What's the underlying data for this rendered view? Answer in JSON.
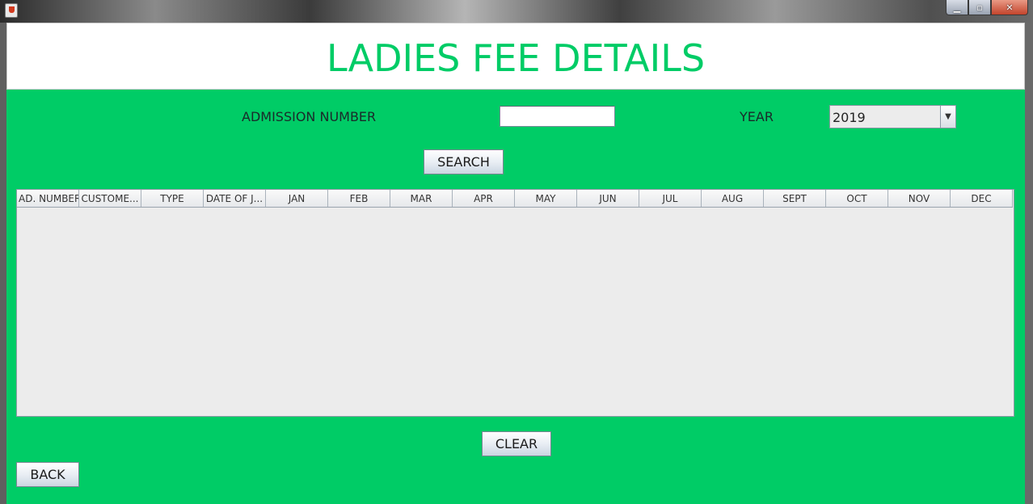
{
  "window": {
    "min_glyph": "▁",
    "max_glyph": "▫",
    "close_glyph": "✕"
  },
  "header": {
    "title": "LADIES FEE DETAILS"
  },
  "form": {
    "admission_label": "ADMISSION NUMBER",
    "admission_value": "",
    "year_label": "YEAR",
    "year_value": "2019",
    "year_arrow": "▼",
    "search_label": "SEARCH"
  },
  "table": {
    "columns": [
      "AD. NUMBER",
      "CUSTOME...",
      "TYPE",
      "DATE OF J...",
      "JAN",
      "FEB",
      "MAR",
      "APR",
      "MAY",
      "JUN",
      "JUL",
      "AUG",
      "SEPT",
      "OCT",
      "NOV",
      "DEC"
    ],
    "rows": []
  },
  "actions": {
    "clear_label": "CLEAR",
    "back_label": "BACK"
  },
  "colors": {
    "accent": "#00cc66",
    "panel": "#00cc66",
    "table_bg": "#ececec"
  }
}
